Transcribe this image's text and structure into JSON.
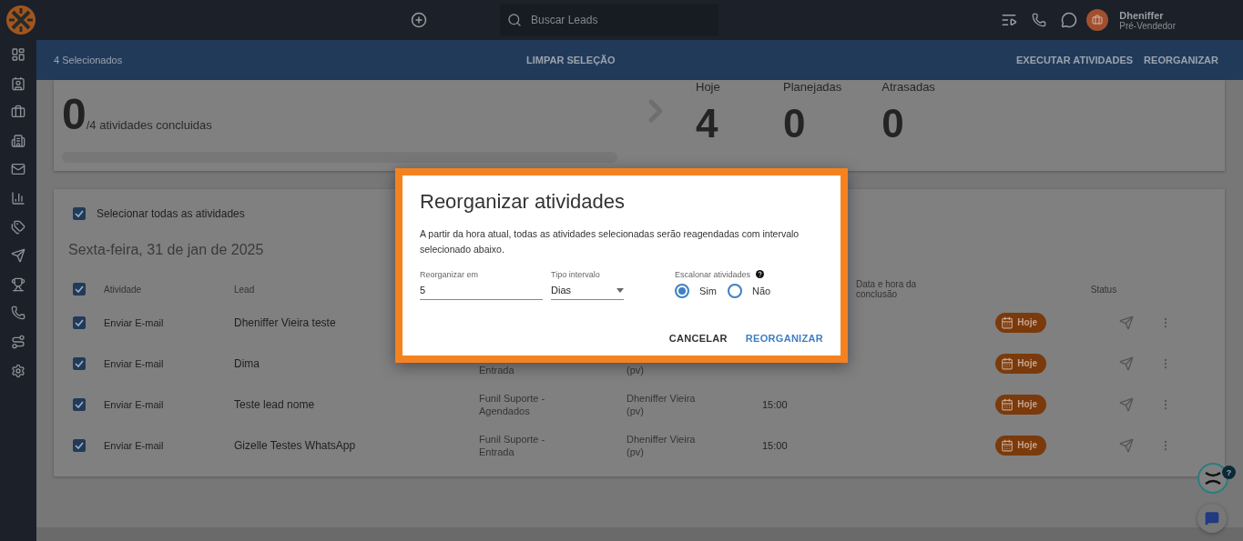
{
  "topbar": {
    "search": {
      "placeholder": "Buscar Leads"
    },
    "user": {
      "name": "Dheniffer",
      "role": "Pré-Vendedor"
    }
  },
  "sidebar": {
    "items": [
      {
        "kind": "dashboard",
        "selected": false
      },
      {
        "kind": "contact",
        "selected": false
      },
      {
        "kind": "briefcase",
        "selected": false
      },
      {
        "kind": "building",
        "selected": false
      },
      {
        "kind": "mail",
        "selected": false
      },
      {
        "kind": "chart",
        "selected": false
      },
      {
        "kind": "tags",
        "selected": false
      },
      {
        "kind": "send",
        "selected": false
      },
      {
        "kind": "trophy",
        "selected": false
      },
      {
        "kind": "phone",
        "selected": false
      },
      {
        "kind": "route",
        "selected": false
      },
      {
        "kind": "settings",
        "selected": false
      }
    ]
  },
  "selection_bar": {
    "count": "4 Selecionados",
    "clear": "LIMPAR SELEÇÃO",
    "actions": [
      "EXECUTAR ATIVIDADES",
      "REORGANIZAR"
    ]
  },
  "summary": {
    "done": "0",
    "total": "/4 atividades concluidas",
    "level": 0,
    "stats": [
      {
        "label": "Hoje",
        "value": "4"
      },
      {
        "label": "Planejadas",
        "value": "0"
      },
      {
        "label": "Atrasadas",
        "value": "0"
      }
    ]
  },
  "activities": {
    "select_all": {
      "label": "Selecionar todas as atividades",
      "checked": true
    },
    "date": "Sexta-feira, 31 de jan de 2025",
    "header_checked": true,
    "columns": [
      "Atividade",
      "Lead",
      "Data e hora da conclusão",
      "Status"
    ],
    "rows": [
      {
        "checked": true,
        "activity": "Enviar E-mail",
        "lead": "Dheniffer Vieira teste",
        "status": "Hoje"
      },
      {
        "checked": true,
        "activity": "Enviar E-mail",
        "lead": "Dima",
        "funnel": "Entrada",
        "owner": "(pv)",
        "status": "Hoje"
      },
      {
        "checked": true,
        "activity": "Enviar E-mail",
        "lead": "Teste lead nome",
        "funnel": "Funil Suporte - Agendados",
        "owner": "Dheniffer Vieira (pv)",
        "time": "15:00",
        "status": "Hoje"
      },
      {
        "checked": true,
        "activity": "Enviar E-mail",
        "lead": "Gizelle Testes WhatsApp",
        "funnel": "Funil Suporte - Entrada",
        "owner": "Dheniffer Vieira (pv)",
        "time": "15:00",
        "status": "Hoje"
      }
    ]
  },
  "dialog": {
    "title": "Reorganizar atividades",
    "text": "A partir da hora atual, todas as atividades selecionadas serão reagendadas com intervalo selecionado abaixo.",
    "interval_field": {
      "label": "Reorganizar em",
      "value": "5"
    },
    "type_field": {
      "label": "Tipo intervalo",
      "value": "Dias"
    },
    "stagger": {
      "label": "Escalonar atividades",
      "options": [
        {
          "label": "Sim",
          "selected": true
        },
        {
          "label": "Não",
          "selected": false
        }
      ]
    },
    "buttons": [
      {
        "label": "CANCELAR",
        "kind": "secondary"
      },
      {
        "label": "REORGANIZAR",
        "kind": "primary"
      }
    ]
  },
  "help_badge": "?"
}
